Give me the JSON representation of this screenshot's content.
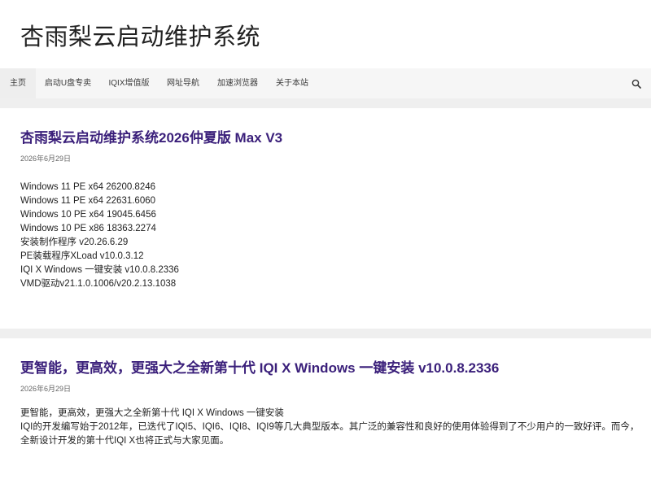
{
  "site": {
    "title": "杏雨梨云启动维护系统"
  },
  "nav": {
    "items": [
      {
        "label": "主页"
      },
      {
        "label": "启动U盘专卖"
      },
      {
        "label": "IQIX增值版"
      },
      {
        "label": "网址导航"
      },
      {
        "label": "加速浏览器"
      },
      {
        "label": "关于本站"
      }
    ],
    "search_icon": "search-icon"
  },
  "posts": [
    {
      "title": "杏雨梨云启动维护系统2026仲夏版 Max V3",
      "date": "2026年6月29日",
      "lines": [
        "Windows 11 PE x64 26200.8246",
        "Windows 11 PE x64 22631.6060",
        "Windows 10 PE x64 19045.6456",
        "Windows 10 PE x86 18363.2274",
        "安装制作程序 v20.26.6.29",
        "PE装载程序XLoad v10.0.3.12",
        "IQI X Windows 一键安装 v10.0.8.2336",
        "VMD驱动v21.1.0.1006/v20.2.13.1038"
      ]
    },
    {
      "title": "更智能，更高效，更强大之全新第十代 IQI X Windows 一键安装 v10.0.8.2336",
      "date": "2026年6月29日",
      "lines": [
        "更智能，更高效，更强大之全新第十代 IQI X Windows 一键安装",
        "IQI的开发编写始于2012年，已迭代了IQI5、IQI6、IQI8、IQI9等几大典型版本。其广泛的兼容性和良好的使用体验得到了不少用户的一致好评。而今，",
        "全新设计开发的第十代IQI X也将正式与大家见面。"
      ]
    }
  ],
  "colors": {
    "post_title": "#3a1f7a",
    "nav_bg": "#f6f6f6",
    "band_bg": "#efefef"
  }
}
